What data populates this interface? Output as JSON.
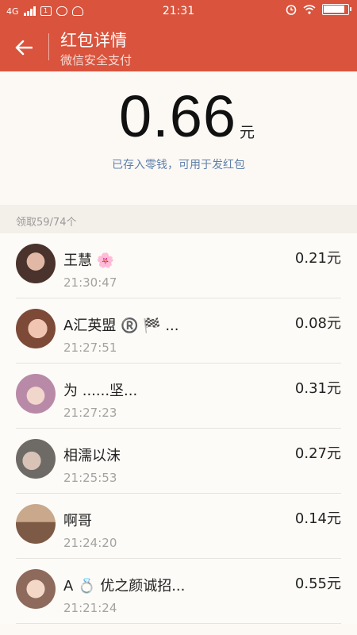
{
  "status_bar": {
    "network": "4G",
    "time": "21:31"
  },
  "header": {
    "title": "红包详情",
    "subtitle": "微信安全支付"
  },
  "amount": {
    "value": "0.66",
    "unit": "元",
    "note": "已存入零钱，可用于发红包"
  },
  "section": {
    "label": "领取59/74个"
  },
  "records": [
    {
      "name": "王慧",
      "emoji": "🌸",
      "time": "21:30:47",
      "amount": "0.21元",
      "avatar_color": "#6b4e45"
    },
    {
      "name": "A汇英盟",
      "emoji": "®️ 🏁 ...",
      "time": "21:27:51",
      "amount": "0.08元",
      "avatar_color": "#9d6a55"
    },
    {
      "name": "为 ......坚...",
      "emoji": "",
      "time": "21:27:23",
      "amount": "0.31元",
      "avatar_color": "#c79fbf"
    },
    {
      "name": "相濡以沫",
      "emoji": "",
      "time": "21:25:53",
      "amount": "0.27元",
      "avatar_color": "#8c8a86"
    },
    {
      "name": "啊哥",
      "emoji": "",
      "time": "21:24:20",
      "amount": "0.14元",
      "avatar_color": "#a5826a"
    },
    {
      "name": "A",
      "emoji": "💍 优之颜诚招...",
      "time": "21:21:24",
      "amount": "0.55元",
      "avatar_color": "#d8b9a9"
    }
  ]
}
